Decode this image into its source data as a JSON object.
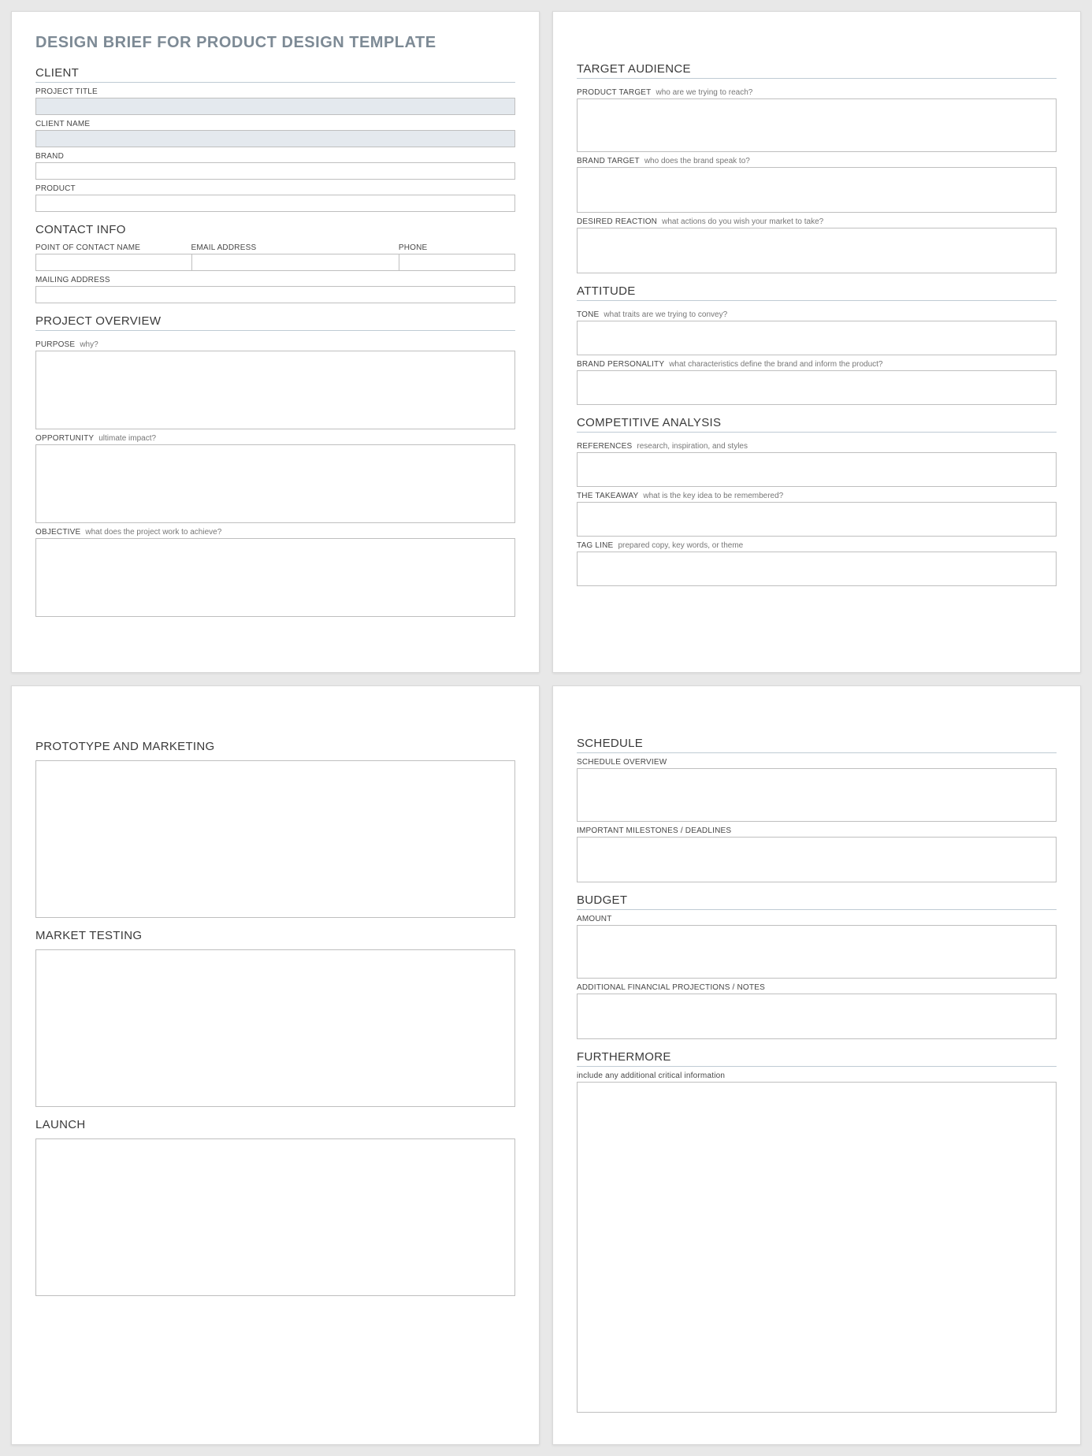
{
  "docTitle": "DESIGN BRIEF FOR PRODUCT DESIGN TEMPLATE",
  "page1": {
    "client": {
      "heading": "CLIENT",
      "projectTitle": "PROJECT TITLE",
      "clientName": "CLIENT NAME",
      "brand": "BRAND",
      "product": "PRODUCT"
    },
    "contact": {
      "heading": "CONTACT INFO",
      "poc": "POINT OF CONTACT NAME",
      "email": "EMAIL ADDRESS",
      "phone": "PHONE",
      "mailing": "MAILING ADDRESS"
    },
    "overview": {
      "heading": "PROJECT OVERVIEW",
      "purpose": "PURPOSE",
      "purposeHint": "why?",
      "opportunity": "OPPORTUNITY",
      "opportunityHint": "ultimate impact?",
      "objective": "OBJECTIVE",
      "objectiveHint": "what does the project work to achieve?"
    }
  },
  "page2": {
    "audience": {
      "heading": "TARGET AUDIENCE",
      "productTarget": "PRODUCT TARGET",
      "productTargetHint": "who are we trying to reach?",
      "brandTarget": "BRAND TARGET",
      "brandTargetHint": "who does the brand speak to?",
      "desired": "DESIRED REACTION",
      "desiredHint": "what actions do you wish your market to take?"
    },
    "attitude": {
      "heading": "ATTITUDE",
      "tone": "TONE",
      "toneHint": "what traits are we trying to convey?",
      "personality": "BRAND PERSONALITY",
      "personalityHint": "what characteristics define the brand and inform the product?"
    },
    "competitive": {
      "heading": "COMPETITIVE ANALYSIS",
      "references": "REFERENCES",
      "referencesHint": "research, inspiration, and styles",
      "takeaway": "THE TAKEAWAY",
      "takeawayHint": "what is the key idea to be remembered?",
      "tagline": "TAG LINE",
      "taglineHint": "prepared copy, key words, or theme"
    }
  },
  "page3": {
    "prototype": "PROTOTYPE AND MARKETING",
    "market": "MARKET TESTING",
    "launch": "LAUNCH"
  },
  "page4": {
    "schedule": {
      "heading": "SCHEDULE",
      "overview": "SCHEDULE OVERVIEW",
      "milestones": "IMPORTANT MILESTONES / DEADLINES"
    },
    "budget": {
      "heading": "BUDGET",
      "amount": "AMOUNT",
      "notes": "ADDITIONAL FINANCIAL PROJECTIONS / NOTES"
    },
    "furthermore": {
      "heading": "FURTHERMORE",
      "hint": "include any additional critical information"
    }
  }
}
